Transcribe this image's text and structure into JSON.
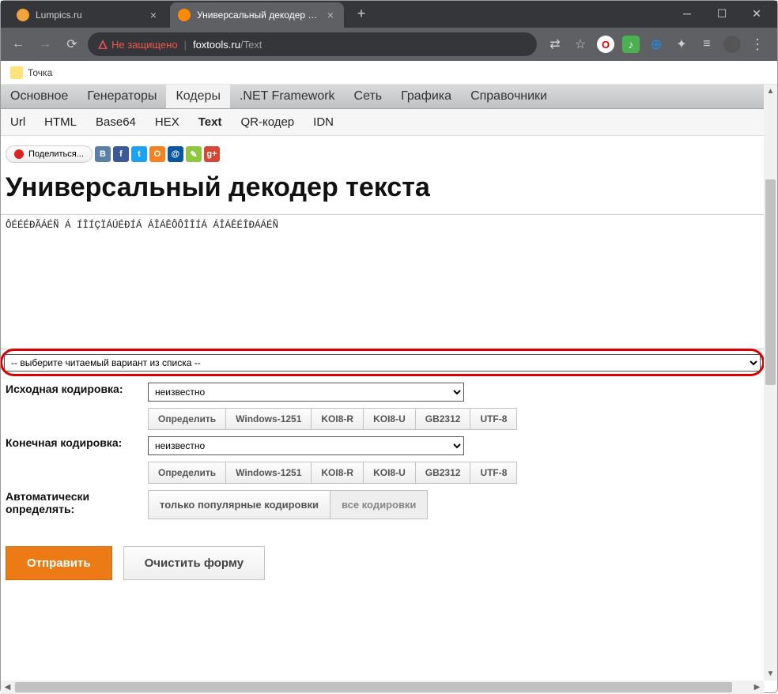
{
  "browser": {
    "tabs": [
      {
        "title": "Lumpics.ru",
        "favcolor": "#f1a33c"
      },
      {
        "title": "Универсальный декодер текста",
        "favcolor": "#ff8a00"
      }
    ],
    "address": {
      "not_secure": "Не защищено",
      "host": "foxtools.ru",
      "path": "/Text"
    },
    "bookmark": "Точка"
  },
  "site": {
    "topnav": [
      "Основное",
      "Генераторы",
      "Кодеры",
      ".NET Framework",
      "Сеть",
      "Графика",
      "Справочники"
    ],
    "topnav_active": 2,
    "subnav": [
      "Url",
      "HTML",
      "Base64",
      "HEX",
      "Text",
      "QR-кодер",
      "IDN"
    ],
    "subnav_active": 4,
    "share_label": "Поделиться...",
    "social": [
      {
        "bg": "#5b7fa6",
        "txt": "B"
      },
      {
        "bg": "#3b5998",
        "txt": "f"
      },
      {
        "bg": "#1da1f2",
        "txt": "t"
      },
      {
        "bg": "#f58220",
        "txt": "O"
      },
      {
        "bg": "#0856a0",
        "txt": "@"
      },
      {
        "bg": "#8fc73e",
        "txt": "✎"
      },
      {
        "bg": "#d34836",
        "txt": "g+"
      }
    ]
  },
  "page": {
    "title": "Универсальный декодер текста",
    "textarea_value": "ÔÉÉÉÐÃÁÉÑ Á ÍÎÍÇÏÁÚÉÐÍÁ ÁÎÁÊÔÔÎÎÍÁ ÁÎÁÊÉÎÐÁÁÉÑ",
    "variant_select": "-- выберите читаемый вариант из списка --",
    "labels": {
      "source": "Исходная кодировка:",
      "target": "Конечная кодировка:",
      "auto": "Автоматически определять:"
    },
    "enc_value": "неизвестно",
    "enc_buttons": [
      "Определить",
      "Windows-1251",
      "KOI8-R",
      "KOI8-U",
      "GB2312",
      "UTF-8"
    ],
    "auto_options": [
      "только популярные кодировки",
      "все кодировки"
    ],
    "actions": {
      "submit": "Отправить",
      "clear": "Очистить форму"
    }
  }
}
